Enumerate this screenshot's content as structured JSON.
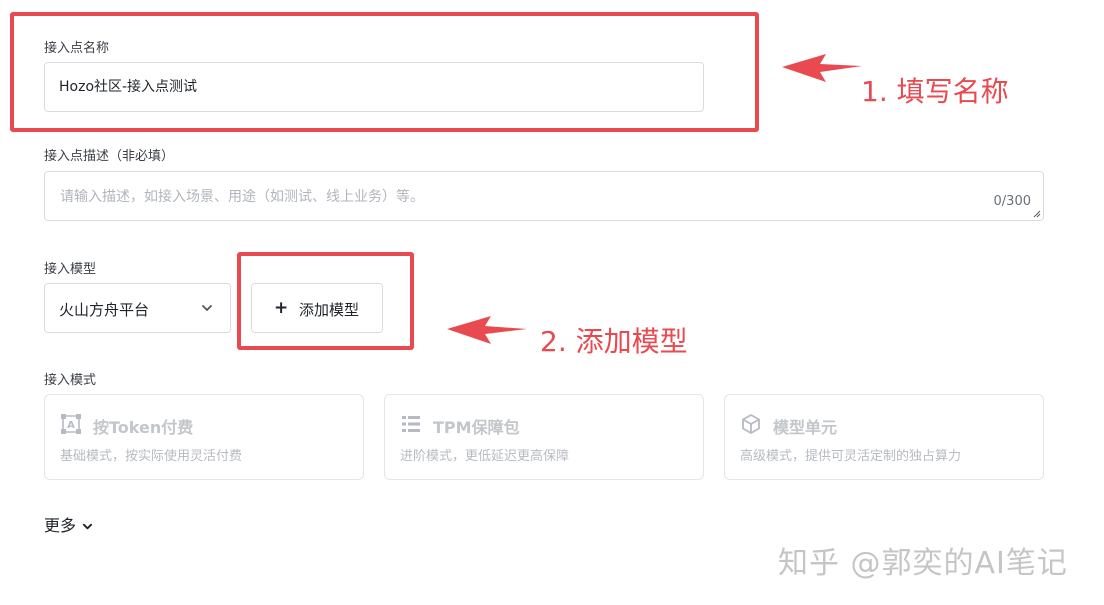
{
  "form": {
    "name_label": "接入点名称",
    "name_value": "Hozo社区-接入点测试",
    "desc_label": "接入点描述（非必填）",
    "desc_placeholder": "请输入描述，如接入场景、用途（如测试、线上业务）等。",
    "desc_count": "0/300",
    "model_label": "接入模型",
    "model_select_value": "火山方舟平台",
    "add_model_button": "添加模型",
    "mode_label": "接入模式",
    "modes": [
      {
        "title": "按Token付费",
        "desc": "基础模式，按实际使用灵活付费",
        "icon": "token-icon"
      },
      {
        "title": "TPM保障包",
        "desc": "进阶模式，更低延迟更高保障",
        "icon": "list-icon"
      },
      {
        "title": "模型单元",
        "desc": "高级模式，提供可灵活定制的独占算力",
        "icon": "cube-icon"
      }
    ],
    "more_label": "更多"
  },
  "annotations": {
    "step1": "1. 填写名称",
    "step2": "2. 添加模型"
  },
  "colors": {
    "annotation_red": "#e84a4f",
    "border": "#d9dce1",
    "disabled_text": "#c3c6cb"
  },
  "watermark": "知乎 @郭奕的AI笔记"
}
